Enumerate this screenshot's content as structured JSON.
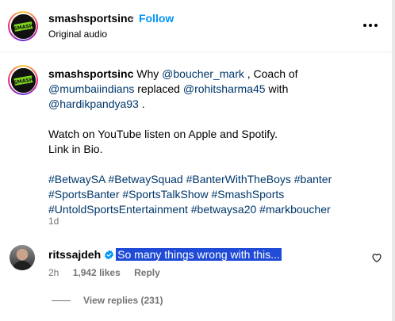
{
  "header": {
    "username": "smashsportsinc",
    "separator": "•",
    "follow_label": "Follow",
    "subtitle": "Original audio"
  },
  "caption": {
    "username": "smashsportsinc",
    "line1_pre": "Why",
    "mention1": "@boucher_mark",
    "line1_mid": ", Coach of",
    "mention2": "@mumbaiindians",
    "line2_mid": "replaced",
    "mention3": "@rohitsharma45",
    "line2_post": "with",
    "mention4": "@hardikpandya93",
    "line3_post": ".",
    "para2_line1": "Watch on YouTube listen on Apple and Spotify.",
    "para2_line2": "Link in Bio.",
    "hashtags_line1": [
      "#BetwaySA",
      "#BetwaySquad",
      "#BanterWithTheBoys",
      "#banter"
    ],
    "hashtags_line2": [
      "#SportsBanter",
      "#SportsTalkShow",
      "#SmashSports"
    ],
    "hashtags_line3": [
      "#UntoldSportsEntertainment",
      "#betwaysa20",
      "#markboucher"
    ],
    "time": "1d"
  },
  "comment": {
    "username": "ritssajdeh",
    "text": "So many things wrong with this...",
    "time": "2h",
    "likes": "1,942 likes",
    "reply_label": "Reply",
    "view_replies": "View replies (231)"
  },
  "logo_text": "SMASH",
  "icons": [
    "more-options-icon",
    "verified-badge-icon",
    "heart-icon"
  ],
  "colors": {
    "follow": "#0095f6",
    "mention": "#00376b",
    "secondary_text": "#737373",
    "highlight": "#1f4bd6",
    "logo_green": "#7ed321"
  }
}
